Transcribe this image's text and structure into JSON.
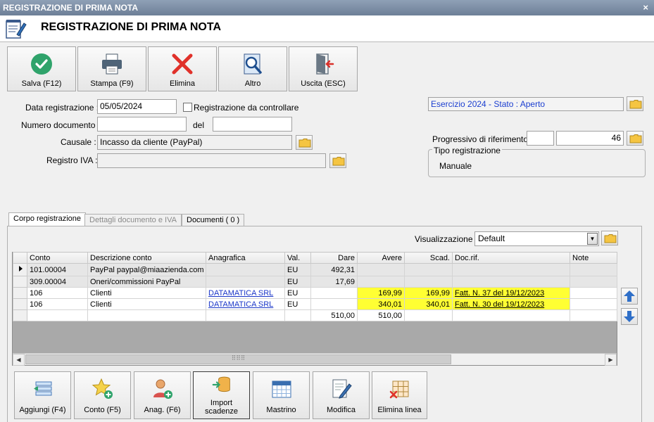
{
  "window": {
    "title": "REGISTRAZIONE DI PRIMA NOTA",
    "close": "×"
  },
  "header": {
    "title": "REGISTRAZIONE DI PRIMA NOTA"
  },
  "toolbar": {
    "save": "Salva (F12)",
    "print": "Stampa (F9)",
    "delete": "Elimina",
    "other": "Altro",
    "exit": "Uscita (ESC)"
  },
  "form": {
    "data_registrazione_label": "Data registrazione :",
    "data_registrazione_value": "05/05/2024",
    "da_controllare_label": "Registrazione da controllare",
    "numero_documento_label": "Numero documento :",
    "numero_documento_value": "",
    "del_label": "del",
    "del_value": "",
    "causale_label": "Causale :",
    "causale_value": "Incasso da cliente (PayPal)",
    "registro_iva_label": "Registro IVA :",
    "registro_iva_value": ""
  },
  "right": {
    "esercizio": "Esercizio 2024 - Stato : Aperto",
    "progressivo_label": "Progressivo di riferimento :",
    "progressivo_a": "",
    "progressivo_b": "46",
    "tipo_label": "Tipo registrazione",
    "tipo_value": "Manuale"
  },
  "tabs": {
    "corpo": "Corpo registrazione",
    "dettagli": "Dettagli documento e IVA",
    "documenti": "Documenti ( 0 )"
  },
  "visualizzazione": {
    "label": "Visualizzazione :",
    "value": "Default"
  },
  "grid": {
    "columns": [
      "Conto",
      "Descrizione conto",
      "Anagrafica",
      "Val.",
      "Dare",
      "Avere",
      "Scad.",
      "Doc.rif.",
      "Note"
    ],
    "rows": [
      {
        "conto": "101.00004",
        "descrizione": "PayPal paypal@miaazienda.com",
        "anagrafica": "",
        "val": "EU",
        "dare": "492,31",
        "avere": "",
        "scad": "",
        "docrif": "",
        "note": ""
      },
      {
        "conto": "309.00004",
        "descrizione": "Oneri/commissioni PayPal",
        "anagrafica": "",
        "val": "EU",
        "dare": "17,69",
        "avere": "",
        "scad": "",
        "docrif": "",
        "note": ""
      },
      {
        "conto": "106",
        "descrizione": "Clienti",
        "anagrafica": "DATAMATICA SRL",
        "val": "EU",
        "dare": "",
        "avere": "169,99",
        "scad": "169,99",
        "docrif": "Fatt. N. 37 del 19/12/2023",
        "note": ""
      },
      {
        "conto": "106",
        "descrizione": "Clienti",
        "anagrafica": "DATAMATICA SRL",
        "val": "EU",
        "dare": "",
        "avere": "340,01",
        "scad": "340,01",
        "docrif": "Fatt. N. 30 del 19/12/2023",
        "note": ""
      }
    ],
    "totals": {
      "dare": "510,00",
      "avere": "510,00"
    },
    "scroll_grip": "⠿⠿⠿"
  },
  "bottom": {
    "aggiungi": "Aggiungi (F4)",
    "conto": "Conto (F5)",
    "anag": "Anag. (F6)",
    "import_1": "Import",
    "import_2": "scadenze",
    "mastrino": "Mastrino",
    "modifica": "Modifica",
    "elimina_linea": "Elimina linea"
  }
}
